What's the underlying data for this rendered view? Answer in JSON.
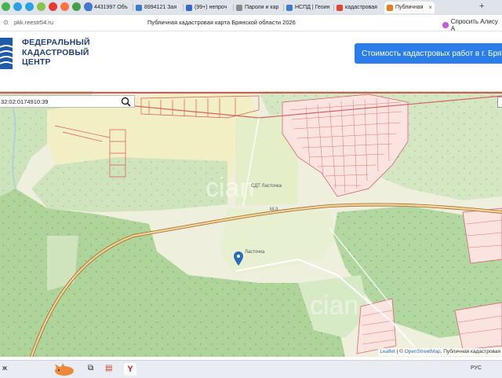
{
  "browser": {
    "tabs": [
      {
        "label": "4431997 Объ",
        "color": "#3a7bd5"
      },
      {
        "label": "8994121 Зая",
        "color": "#3a7bd5"
      },
      {
        "label": "(99+) непроч",
        "color": "#2e6bd6"
      },
      {
        "label": "Пароли и кар",
        "color": "#8a8a8a"
      },
      {
        "label": "НСПД | Геоин",
        "color": "#3a7bd5"
      },
      {
        "label": "кадастровая",
        "color": "#e8442c"
      },
      {
        "label": "Публичная",
        "color": "#f07a1a"
      }
    ],
    "address_url": "pkk.reestr54.ru",
    "page_title": "Публичная кадастровая карта Брянской области 2026",
    "ask_alisa": "Спросить Алису А"
  },
  "site": {
    "logo_line1": "ФЕДЕРАЛЬНЫЙ",
    "logo_line2": "КАДАСТРОВЫЙ",
    "logo_line3": "ЦЕНТР",
    "cta_label": "Стоимость кадастровых работ в г. Брянс"
  },
  "map": {
    "search_value": "32:02:0174910:39",
    "label_sdt": "СДТ Ласточка",
    "label_lastochka": "Ласточка",
    "label_road": "М-3",
    "attribution_leaflet": "Leaflet",
    "attribution_sep": " | © ",
    "attribution_osm": "OpenStreetMap",
    "attribution_rest": ", Публичная кадастровая"
  },
  "taskbar": {
    "left_text": "ж",
    "lang": "РУС",
    "yandex_label": "Y"
  }
}
